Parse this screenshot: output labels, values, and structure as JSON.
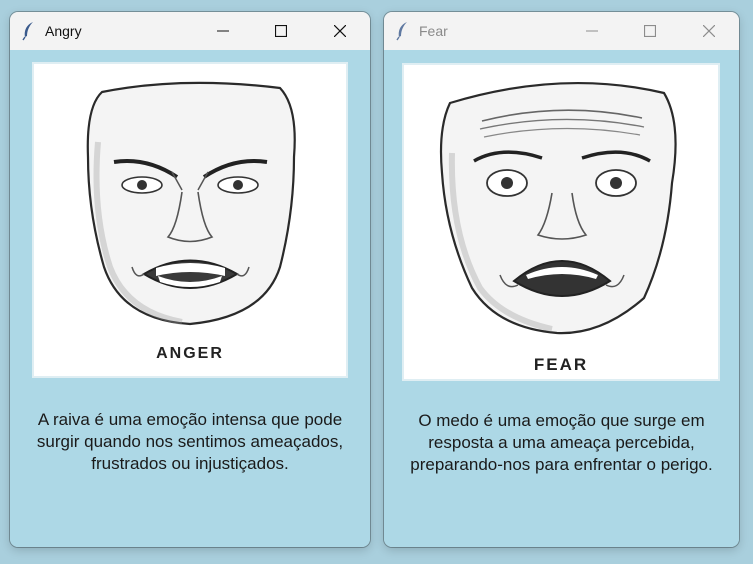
{
  "windows": {
    "angry": {
      "title": "Angry",
      "icon": "feather-icon",
      "image_caption": "ANGER",
      "description_lines": [
        "A raiva é uma emoção intensa que pode",
        "surgir quando nos sentimos ameaçados,",
        "frustrados ou injustiçados."
      ]
    },
    "fear": {
      "title": "Fear",
      "icon": "feather-icon",
      "image_caption": "FEAR",
      "description_lines": [
        "O medo é uma emoção que surge em",
        "resposta a uma ameaça percebida,",
        "preparando-nos para enfrentar o perigo."
      ]
    }
  },
  "colors": {
    "desktop": "#a9cfdd",
    "client_background": "#add8e6",
    "titlebar": "#f3f3f3"
  }
}
